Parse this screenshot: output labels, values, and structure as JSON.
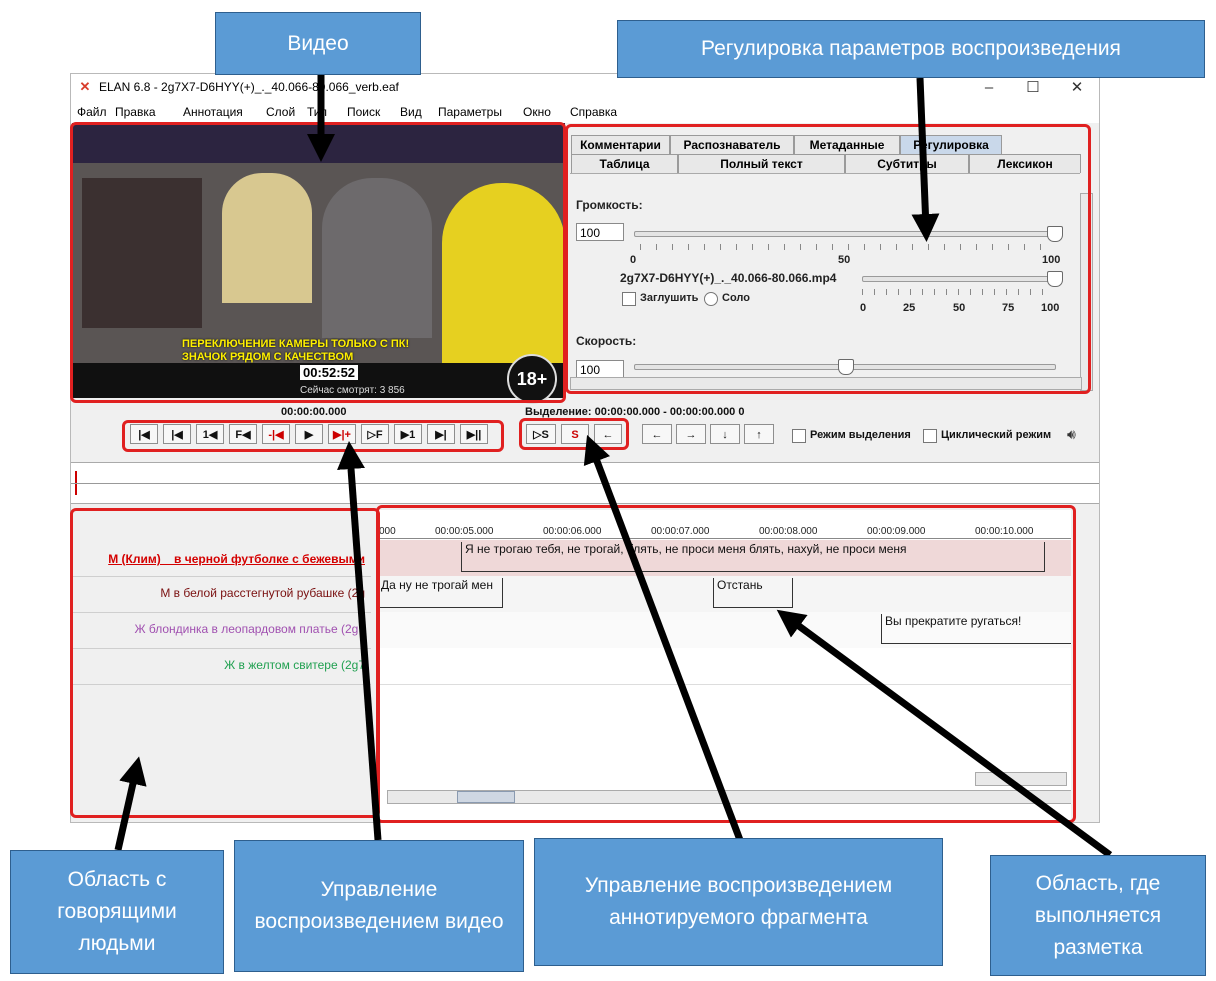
{
  "window": {
    "title": "ELAN 6.8 - 2g7X7-D6HYY(+)_._40.066-80.066_verb.eaf",
    "icon": "elan-x-icon",
    "controls": [
      "–",
      "☐",
      "✕"
    ]
  },
  "menu": [
    "Файл",
    "Правка",
    "Аннотация",
    "Слой",
    "Тип",
    "Поиск",
    "Вид",
    "Параметры",
    "Окно",
    "Справка"
  ],
  "video": {
    "overlay_line1": "ПЕРЕКЛЮЧЕНИЕ КАМЕРЫ ТОЛЬКО С ПК!",
    "overlay_line2": "ЗНАЧОК РЯДОМ С КАЧЕСТВОМ",
    "stream_time": "00:52:52",
    "viewers": "Сейчас смотрят: 3 856",
    "age_badge": "18+"
  },
  "tabs_row1": [
    "Комментарии",
    "Распознаватель",
    "Метаданные",
    "Регулировка"
  ],
  "tabs_row2": [
    "Таблица",
    "Полный текст",
    "Субтитры",
    "Лексикон"
  ],
  "controls": {
    "volume_label": "Громкость:",
    "volume_value": "100",
    "volume_level": 1.0,
    "scale_a": [
      "0",
      "50",
      "100"
    ],
    "media_file": "2g7X7-D6HYY(+)_._40.066-80.066.mp4",
    "mute_label": "Заглушить",
    "solo_label": "Соло",
    "scale_b": [
      "0",
      "25",
      "50",
      "75",
      "100"
    ],
    "speed_label": "Скорость:",
    "speed_value": "100"
  },
  "transport": {
    "time": "00:00:00.000",
    "selection": "Выделение: 00:00:00.000 - 00:00:00.000  0",
    "buttons": [
      "|◀",
      "|◀",
      "1◀",
      "F◀",
      "-|◀",
      "▶",
      "▶|+",
      "▷F",
      "▶1",
      "▶|",
      "▶||"
    ],
    "selection_buttons": [
      "▷S",
      "S",
      "←"
    ],
    "nav_buttons": [
      "←",
      "→",
      "↓",
      "↑"
    ],
    "selection_mode": "Режим выделения",
    "loop_mode": "Циклический режим"
  },
  "tiers": [
    {
      "name": "М (Клим)__в черной футболке с бежевыми",
      "color": "#d40000"
    },
    {
      "name": "М в белой расстегнутой рубашке (2g",
      "color": "#7a1010"
    },
    {
      "name": "Ж блондинка в леопардовом платье (2g7",
      "color": "#a050b0"
    },
    {
      "name": "Ж в желтом свитере (2g7",
      "color": "#20a050"
    }
  ],
  "ruler": [
    "000",
    "00:00:05.000",
    "00:00:06.000",
    "00:00:07.000",
    "00:00:08.000",
    "00:00:09.000",
    "00:00:10.000"
  ],
  "annotations": {
    "a1": "Я не трогаю тебя, не трогай, блять, не проси меня блять, нахуй, не проси меня",
    "a2": "Да ну не трогай мен",
    "a3": "Отстань",
    "a4": "Вы прекратите ругаться!"
  },
  "callouts": {
    "video": "Видео",
    "params": "Регулировка параметров воспроизведения",
    "speakers": "Область с говорящими людьми",
    "video_control": "Управление воспроизведением видео",
    "fragment_control": "Управление воспроизведением аннотируемого фрагмента",
    "markup": "Область, где выполняется разметка"
  }
}
